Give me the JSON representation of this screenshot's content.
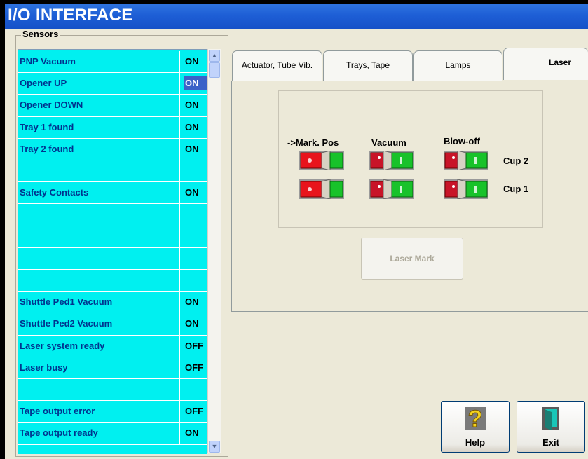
{
  "window": {
    "title": "I/O INTERFACE"
  },
  "sensors": {
    "legend": "Sensors",
    "rows": [
      {
        "name": "PNP Vacuum",
        "value": "ON"
      },
      {
        "name": "Opener UP",
        "value": "ON",
        "selected": true
      },
      {
        "name": "Opener DOWN",
        "value": "ON"
      },
      {
        "name": "Tray 1 found",
        "value": "ON"
      },
      {
        "name": "Tray 2 found",
        "value": "ON"
      },
      {
        "name": "",
        "value": ""
      },
      {
        "name": "Safety Contacts",
        "value": "ON"
      },
      {
        "name": "",
        "value": ""
      },
      {
        "name": "",
        "value": ""
      },
      {
        "name": "",
        "value": ""
      },
      {
        "name": "",
        "value": ""
      },
      {
        "name": "Shuttle Ped1 Vacuum",
        "value": "ON"
      },
      {
        "name": "Shuttle Ped2 Vacuum",
        "value": "ON"
      },
      {
        "name": "Laser system ready",
        "value": "OFF"
      },
      {
        "name": "Laser busy",
        "value": "OFF"
      },
      {
        "name": "",
        "value": ""
      },
      {
        "name": "Tape output error",
        "value": "OFF"
      },
      {
        "name": "Tape output ready",
        "value": "ON"
      }
    ]
  },
  "tabs": [
    {
      "label": "Actuator, Tube Vib."
    },
    {
      "label": "Trays, Tape"
    },
    {
      "label": "Lamps"
    },
    {
      "label": "Laser",
      "active": true
    }
  ],
  "laser_panel": {
    "columns": [
      "->Mark. Pos",
      "Vacuum",
      "Blow-off"
    ],
    "cups": [
      "Cup 2",
      "Cup 1"
    ],
    "laser_mark_button": "Laser Mark"
  },
  "buttons": {
    "help": "Help",
    "exit": "Exit"
  },
  "colors": {
    "list_bg": "#00F0F0",
    "row_text": "#00338E",
    "switch_red": "#E8141C",
    "switch_green": "#18C22A",
    "title_bar": "#2F74E0"
  }
}
